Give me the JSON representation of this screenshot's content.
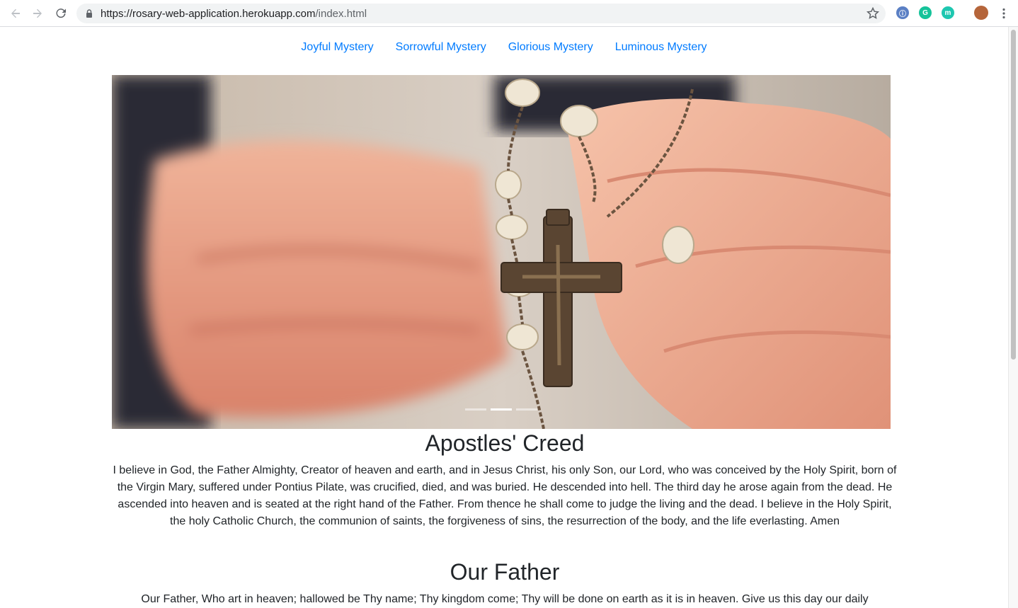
{
  "browser": {
    "url_host": "https://rosary-web-application.herokuapp.com",
    "url_path": "/index.html"
  },
  "nav": [
    {
      "label": "Joyful Mystery"
    },
    {
      "label": "Sorrowful Mystery"
    },
    {
      "label": "Glorious Mystery"
    },
    {
      "label": "Luminous Mystery"
    }
  ],
  "carousel": {
    "image": "hands holding rosary with crucifix",
    "slide_count": 3,
    "active_slide": 2
  },
  "prayers": [
    {
      "title": "Apostles' Creed",
      "text": "I believe in God, the Father Almighty, Creator of heaven and earth, and in Jesus Christ, his only Son, our Lord, who was conceived by the Holy Spirit, born of the Virgin Mary, suffered under Pontius Pilate, was crucified, died, and was buried. He descended into hell. The third day he arose again from the dead. He ascended into heaven and is seated at the right hand of the Father. From thence he shall come to judge the living and the dead. I believe in the Holy Spirit, the holy Catholic Church, the communion of saints, the forgiveness of sins, the resurrection of the body, and the life everlasting. Amen"
    },
    {
      "title": "Our Father",
      "text": "Our Father, Who art in heaven; hallowed be Thy name; Thy kingdom come; Thy will be done on earth as it is in heaven. Give us this day our daily"
    }
  ],
  "colors": {
    "link": "#007bff",
    "text": "#212529"
  }
}
